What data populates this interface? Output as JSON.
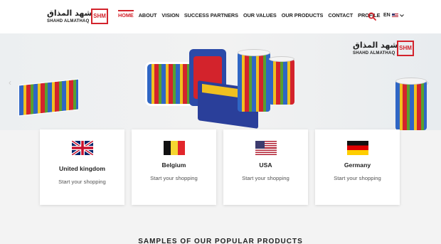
{
  "brand": {
    "arabic": "شهد المذاق",
    "latin": "SHAHD ALMATHAQ",
    "badge": "SHM"
  },
  "nav": {
    "items": [
      {
        "label": "HOME",
        "active": true
      },
      {
        "label": "ABOUT",
        "active": false
      },
      {
        "label": "VISION",
        "active": false
      },
      {
        "label": "SUCCESS PARTNERS",
        "active": false
      },
      {
        "label": "OUR VALUES",
        "active": false
      },
      {
        "label": "OUR PRODUCTS",
        "active": false
      },
      {
        "label": "CONTACT",
        "active": false
      },
      {
        "label": "PROFILE",
        "active": false
      }
    ],
    "language": "EN"
  },
  "hero": {
    "prev_arrow": "‹",
    "next_arrow": "›"
  },
  "countries": [
    {
      "name": "United kingdom",
      "cta": "Start your shopping",
      "flag": "uk-flag-icon"
    },
    {
      "name": "Belgium",
      "cta": "Start your shopping",
      "flag": "belgium-flag-icon"
    },
    {
      "name": "USA",
      "cta": "Start your shopping",
      "flag": "usa-flag-icon"
    },
    {
      "name": "Germany",
      "cta": "Start your shopping",
      "flag": "germany-flag-icon"
    }
  ],
  "section": {
    "title": "SAMPLES OF OUR POPULAR PRODUCTS"
  },
  "colors": {
    "accent": "#d3232c",
    "text": "#222222"
  }
}
